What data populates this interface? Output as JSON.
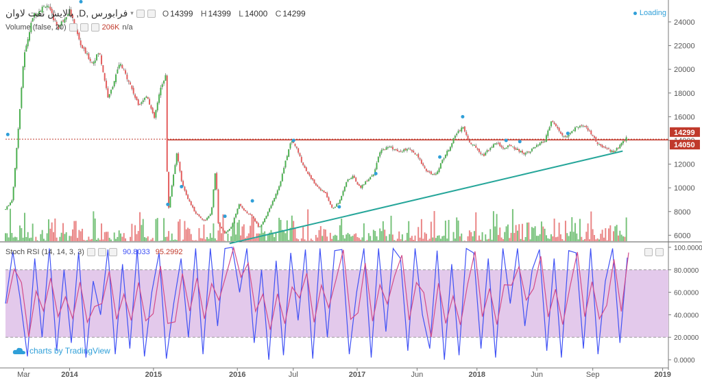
{
  "header": {
    "symbol": "بالایش نفت لاوان ,D, فرابورس",
    "ohlc": [
      {
        "key": "O",
        "value": "14399"
      },
      {
        "key": "H",
        "value": "14399"
      },
      {
        "key": "L",
        "value": "14000"
      },
      {
        "key": "C",
        "value": "14299"
      }
    ],
    "volume_label": "Volume (false, 20)",
    "volume_value": "206K",
    "volume_na": "n/a",
    "loading": "Loading"
  },
  "stoch": {
    "label": "Stoch RSI (14, 14, 3, 3)",
    "k_value": "90.8033",
    "d_value": "95.2992"
  },
  "watermark": "charts by TradingView",
  "colors": {
    "up": "#4caf50",
    "down": "#e35d5d",
    "wick": "#666666",
    "resistance": "#c0392b",
    "trendline": "#26a69a",
    "stoch_k": "#3f51f5",
    "stoch_d": "#d24b8a",
    "stoch_band": "#e3c9eb",
    "loading": "#2f9fd8"
  },
  "chart_data": [
    {
      "type": "candlestick",
      "title": "بالایش نفت لاوان ,D, فرابورس",
      "y_ticks": [
        6000,
        8000,
        10000,
        12000,
        14000,
        16000,
        18000,
        20000,
        22000,
        24000
      ],
      "ylim": [
        5500,
        25500
      ],
      "x_ticks": [
        "Mar",
        "2014",
        "2015",
        "2016",
        "Jul",
        "2017",
        "Jun",
        "2018",
        "Jun",
        "Sep",
        "2019"
      ],
      "price_tags": [
        {
          "value": 14299,
          "label": "14299",
          "color": "#c0392b"
        },
        {
          "value": 14050,
          "label": "14050",
          "color": "#c0392b"
        }
      ],
      "resistance_level": 14050,
      "trendline": [
        [
          5,
          5300
        ],
        [
          27,
          13100
        ]
      ],
      "close_path": [
        [
          0,
          8200
        ],
        [
          0.3,
          9000
        ],
        [
          0.5,
          13500
        ],
        [
          0.8,
          21000
        ],
        [
          1.2,
          24500
        ],
        [
          1.8,
          25500
        ],
        [
          2.3,
          23500
        ],
        [
          2.8,
          25000
        ],
        [
          3.3,
          22000
        ],
        [
          3.8,
          20500
        ],
        [
          4.1,
          21500
        ],
        [
          4.5,
          17500
        ],
        [
          5,
          20500
        ],
        [
          5.4,
          19000
        ],
        [
          5.8,
          17000
        ],
        [
          6.2,
          17800
        ],
        [
          6.5,
          15800
        ],
        [
          6.8,
          18500
        ],
        [
          7.0,
          19500
        ],
        [
          7.1,
          7800
        ],
        [
          7.3,
          10500
        ],
        [
          7.5,
          13000
        ],
        [
          7.7,
          10500
        ],
        [
          8,
          9000
        ],
        [
          8.3,
          7900
        ],
        [
          8.7,
          7200
        ],
        [
          9.0,
          7800
        ],
        [
          9.2,
          11800
        ],
        [
          9.3,
          7000
        ],
        [
          9.6,
          6100
        ],
        [
          9.9,
          6800
        ],
        [
          10.2,
          8600
        ],
        [
          10.5,
          8000
        ],
        [
          10.8,
          7600
        ],
        [
          11.1,
          6600
        ],
        [
          11.5,
          8000
        ],
        [
          12.0,
          10300
        ],
        [
          12.3,
          12600
        ],
        [
          12.5,
          14000
        ],
        [
          12.7,
          13500
        ],
        [
          13.0,
          12000
        ],
        [
          13.3,
          11000
        ],
        [
          13.6,
          10200
        ],
        [
          14.0,
          9500
        ],
        [
          14.3,
          8200
        ],
        [
          14.6,
          8800
        ],
        [
          14.9,
          10500
        ],
        [
          15.2,
          11000
        ],
        [
          15.5,
          10000
        ],
        [
          15.8,
          10600
        ],
        [
          16.1,
          11200
        ],
        [
          16.4,
          13100
        ],
        [
          16.8,
          13500
        ],
        [
          17.2,
          13000
        ],
        [
          17.6,
          13300
        ],
        [
          18.0,
          12700
        ],
        [
          18.4,
          11500
        ],
        [
          18.8,
          11000
        ],
        [
          19.1,
          12300
        ],
        [
          19.4,
          13300
        ],
        [
          19.7,
          14500
        ],
        [
          20.0,
          15200
        ],
        [
          20.3,
          13800
        ],
        [
          20.6,
          13400
        ],
        [
          20.9,
          12700
        ],
        [
          21.2,
          13400
        ],
        [
          21.5,
          13800
        ],
        [
          21.8,
          13300
        ],
        [
          22.1,
          13600
        ],
        [
          22.4,
          13200
        ],
        [
          22.7,
          12900
        ],
        [
          23.0,
          13200
        ],
        [
          23.3,
          13600
        ],
        [
          23.6,
          14000
        ],
        [
          23.9,
          15700
        ],
        [
          24.2,
          14800
        ],
        [
          24.5,
          14200
        ],
        [
          24.8,
          14800
        ],
        [
          25.1,
          15300
        ],
        [
          25.4,
          15100
        ],
        [
          25.7,
          14300
        ],
        [
          26.0,
          13500
        ],
        [
          26.3,
          13300
        ],
        [
          26.6,
          13000
        ],
        [
          26.9,
          13600
        ],
        [
          27.2,
          14299
        ]
      ],
      "volume_height_fraction_max": 0.15,
      "markers": [
        {
          "x": 0.1,
          "value": 14500,
          "color": "#2f9fd8"
        },
        {
          "x": 3.3,
          "value": 25700,
          "color": "#2f9fd8"
        },
        {
          "x": 7.1,
          "value": 8600,
          "color": "#2f9fd8"
        },
        {
          "x": 7.7,
          "value": 10100,
          "color": "#2f9fd8"
        },
        {
          "x": 9.6,
          "value": 7600,
          "color": "#2f9fd8"
        },
        {
          "x": 10.8,
          "value": 8900,
          "color": "#2f9fd8"
        },
        {
          "x": 12.6,
          "value": 14000,
          "color": "#2f9fd8"
        },
        {
          "x": 14.6,
          "value": 8400,
          "color": "#2f9fd8"
        },
        {
          "x": 16.2,
          "value": 11200,
          "color": "#2f9fd8"
        },
        {
          "x": 19.0,
          "value": 12600,
          "color": "#2f9fd8"
        },
        {
          "x": 20.0,
          "value": 16000,
          "color": "#2f9fd8"
        },
        {
          "x": 21.9,
          "value": 14000,
          "color": "#2f9fd8"
        },
        {
          "x": 22.5,
          "value": 13900,
          "color": "#2f9fd8"
        },
        {
          "x": 24.6,
          "value": 14600,
          "color": "#2f9fd8"
        }
      ]
    },
    {
      "type": "line",
      "title": "Stoch RSI (14, 14, 3, 3)",
      "y_ticks": [
        0,
        20,
        40,
        60,
        80,
        100
      ],
      "y_tick_labels": [
        "0.0000",
        "20.0000",
        "40.0000",
        "60.0000",
        "80.0000",
        "100.0000"
      ],
      "ylim": [
        -3,
        103
      ],
      "band": [
        20,
        80
      ],
      "series": [
        {
          "name": "K",
          "last_value": 90.8033,
          "color": "#3f51f5"
        },
        {
          "name": "D",
          "last_value": 95.2992,
          "color": "#d24b8a"
        }
      ],
      "knots": [
        50,
        96,
        55,
        3,
        90,
        20,
        99,
        8,
        80,
        15,
        96,
        2,
        70,
        40,
        98,
        5,
        85,
        10,
        98,
        3,
        60,
        95,
        1,
        50,
        90,
        20,
        99,
        5,
        99,
        30,
        99,
        100,
        60,
        99,
        15,
        80,
        0,
        88,
        4,
        95,
        35,
        98,
        1,
        99,
        20,
        97,
        98,
        5,
        60,
        99,
        2,
        99,
        25,
        99,
        90,
        8,
        99,
        40,
        10,
        97,
        0,
        85,
        4,
        99,
        95,
        10,
        90,
        2,
        99,
        50,
        99,
        30,
        80,
        98,
        8,
        90,
        2,
        97,
        95,
        10,
        99,
        5,
        70,
        99,
        15,
        92
      ]
    }
  ]
}
